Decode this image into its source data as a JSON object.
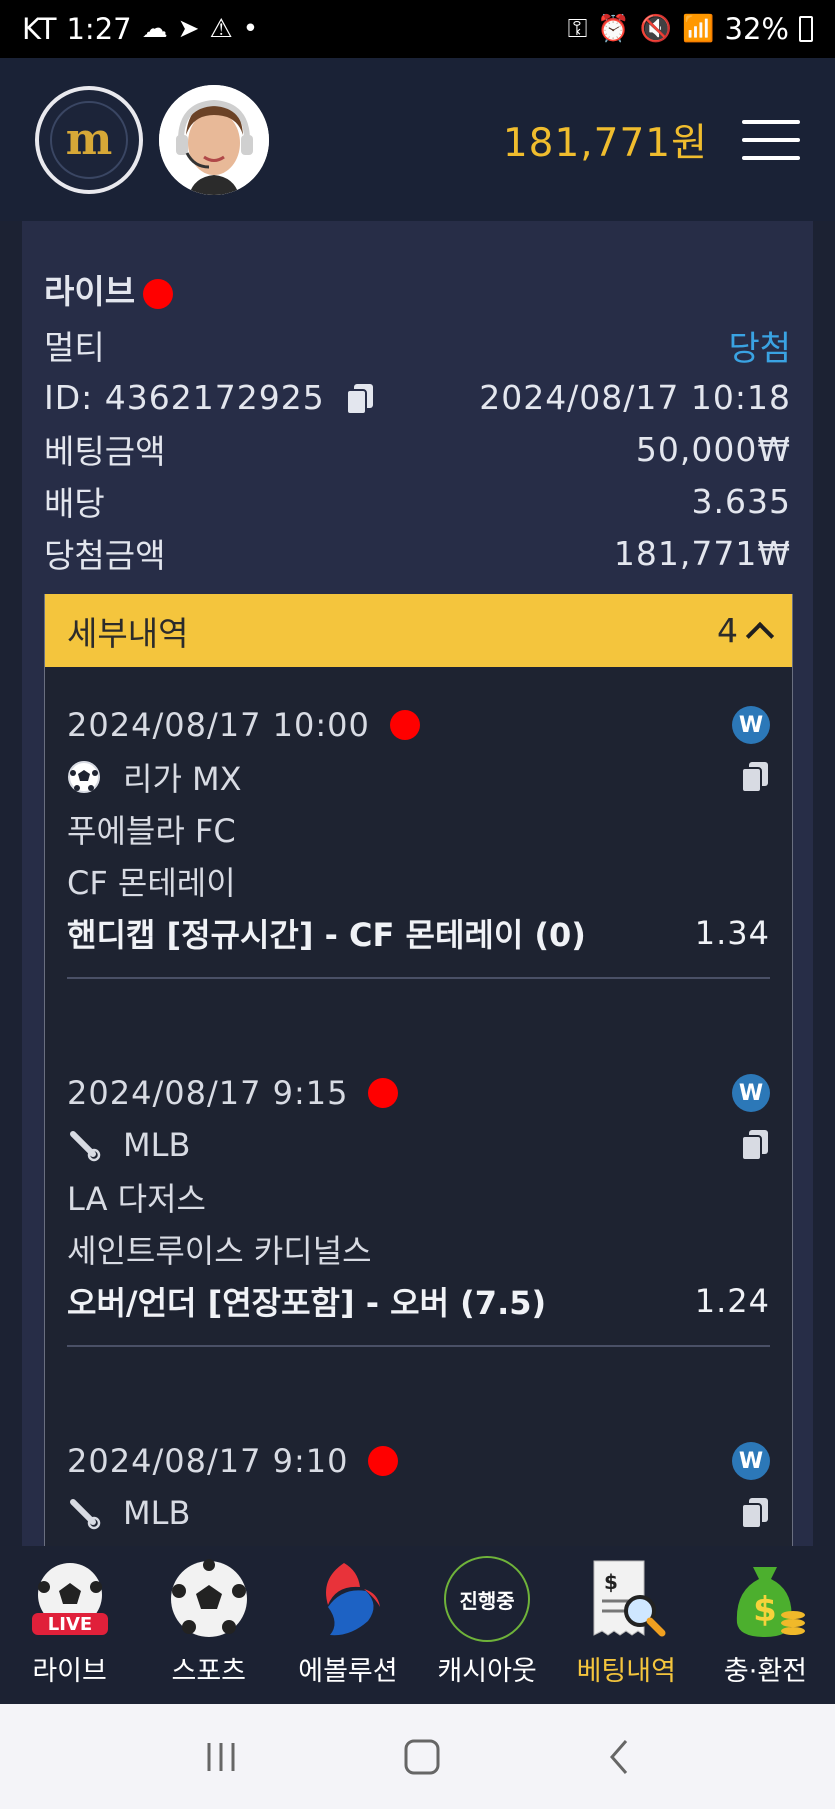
{
  "status_bar": {
    "carrier": "KT",
    "time": "1:27",
    "battery": "32%"
  },
  "header": {
    "balance": "181,771원"
  },
  "summary": {
    "type_label": "라이브",
    "bet_kind": "멀티",
    "result": "당첨",
    "id_label": "ID: 4362172925",
    "datetime": "2024/08/17 10:18",
    "stake_label": "베팅금액",
    "stake_value": "50,000₩",
    "odds_label": "배당",
    "odds_value": "3.635",
    "payout_label": "당첨금액",
    "payout_value": "181,771₩"
  },
  "details": {
    "title": "세부내역",
    "count": "4",
    "bets": [
      {
        "datetime": "2024/08/17 10:00",
        "badge": "W",
        "sport_icon": "soccer-ball-icon",
        "league": "리가 MX",
        "home": "푸에블라 FC",
        "away": "CF 몬테레이",
        "pick": "핸디캡 [정규시간] - CF 몬테레이 (0)",
        "odds": "1.34"
      },
      {
        "datetime": "2024/08/17 9:15",
        "badge": "W",
        "sport_icon": "baseball-bat-icon",
        "league": "MLB",
        "home": "LA 다저스",
        "away": "세인트루이스 카디널스",
        "pick": "오버/언더 [연장포함] - 오버 (7.5)",
        "odds": "1.24"
      },
      {
        "datetime": "2024/08/17 9:10",
        "badge": "W",
        "sport_icon": "baseball-bat-icon",
        "league": "MLB"
      }
    ]
  },
  "nav": {
    "items": [
      {
        "label": "라이브",
        "icon": "live-ball-icon"
      },
      {
        "label": "스포츠",
        "icon": "soccer-ball-icon"
      },
      {
        "label": "에볼루션",
        "icon": "evolution-logo-icon"
      },
      {
        "label": "캐시아웃",
        "icon": "cashout-icon",
        "icon_text": "진행중"
      },
      {
        "label": "베팅내역",
        "icon": "receipt-search-icon",
        "active": true
      },
      {
        "label": "충·환전",
        "icon": "money-bag-icon"
      }
    ]
  },
  "colors": {
    "accent": "#f4c53d",
    "won": "#3aa3e3",
    "live_dot": "#ff0000"
  }
}
